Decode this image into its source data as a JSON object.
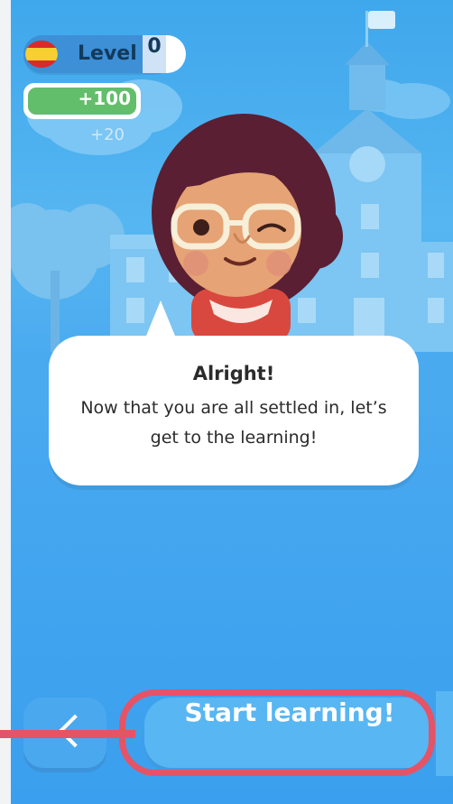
{
  "header": {
    "language_flag": "spain-flag-icon",
    "level_label": "Level",
    "level_value": "0",
    "xp_total": "+100",
    "xp_gain": "+20"
  },
  "dialog": {
    "title": "Alright!",
    "message": "Now that you are all settled in, let’s get to the learning!"
  },
  "actions": {
    "back_icon": "chevron-left-icon",
    "start_label": "Start learning!"
  },
  "colors": {
    "sky_top": "#3fa7ec",
    "sky_bottom": "#3a9fee",
    "xp_green": "#63be6c",
    "highlight": "#e55366",
    "button": "#58b6f3"
  }
}
